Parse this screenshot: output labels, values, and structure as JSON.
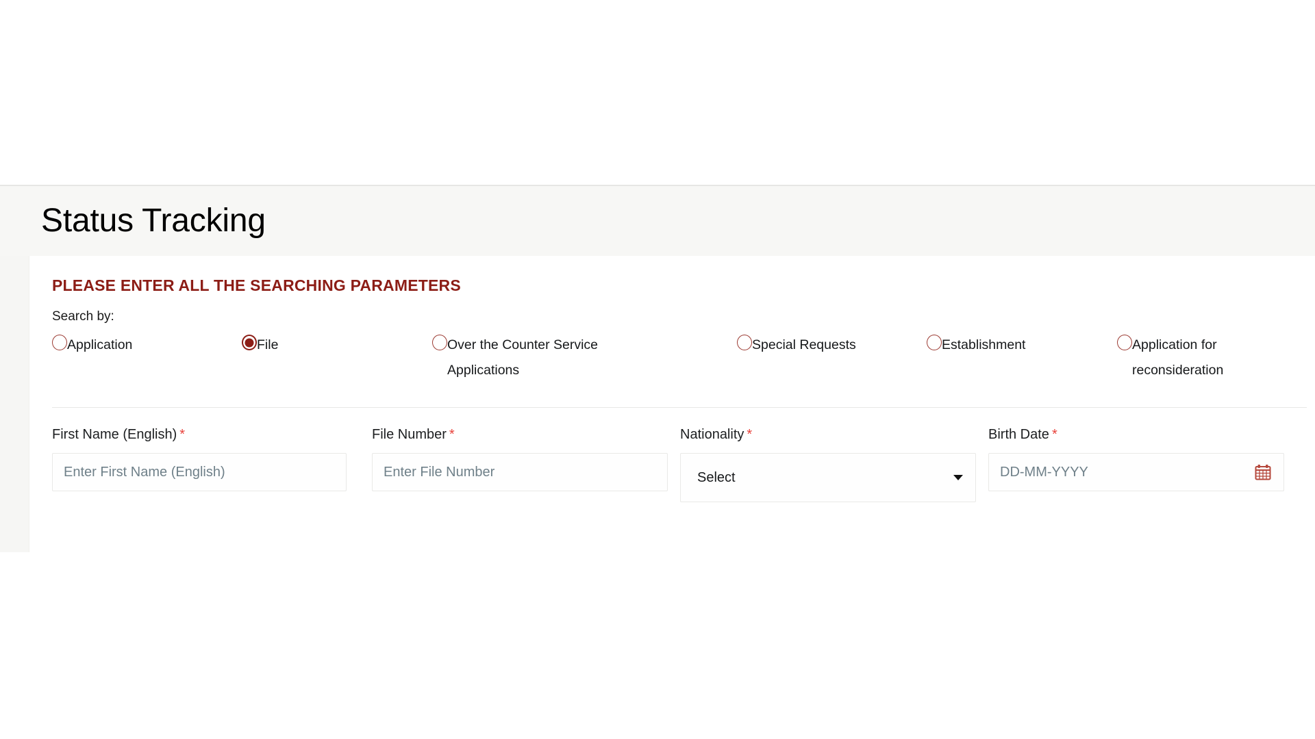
{
  "page": {
    "title": "Status Tracking"
  },
  "card": {
    "heading": "PLEASE ENTER ALL THE SEARCHING PARAMETERS",
    "search_by_label": "Search by:"
  },
  "colors": {
    "heading_maroon": "#8c1d16",
    "radio_ring": "#9c3b33",
    "radio_selected": "#8c1d16",
    "required_star": "#e8413a",
    "placeholder_text": "#6f8089",
    "calendar_icon": "#b5483c",
    "page_background": "#f6f6f4",
    "card_background": "#ffffff"
  },
  "search_by": {
    "selected": "File",
    "options": [
      {
        "label": "Application",
        "checked": false,
        "icon": "radio-unchecked-icon"
      },
      {
        "label": "File",
        "checked": true,
        "icon": "radio-checked-icon"
      },
      {
        "label": "Over the Counter Service Applications",
        "checked": false,
        "icon": "radio-unchecked-icon"
      },
      {
        "label": "Special Requests",
        "checked": false,
        "icon": "radio-unchecked-icon"
      },
      {
        "label": "Establishment",
        "checked": false,
        "icon": "radio-unchecked-icon"
      },
      {
        "label": "Application for reconsideration",
        "checked": false,
        "icon": "radio-unchecked-icon"
      }
    ]
  },
  "fields": {
    "first_name": {
      "label": "First Name (English)",
      "required_marker": "*",
      "placeholder": "Enter First Name (English)",
      "value": ""
    },
    "file_number": {
      "label": "File Number",
      "required_marker": "*",
      "placeholder": "Enter File Number",
      "value": ""
    },
    "nationality": {
      "label": "Nationality",
      "required_marker": "*",
      "selected_option": "Select",
      "icon": "chevron-down-icon"
    },
    "birth_date": {
      "label": "Birth Date",
      "required_marker": "*",
      "placeholder": "DD-MM-YYYY",
      "value": "",
      "icon": "calendar-icon"
    }
  }
}
